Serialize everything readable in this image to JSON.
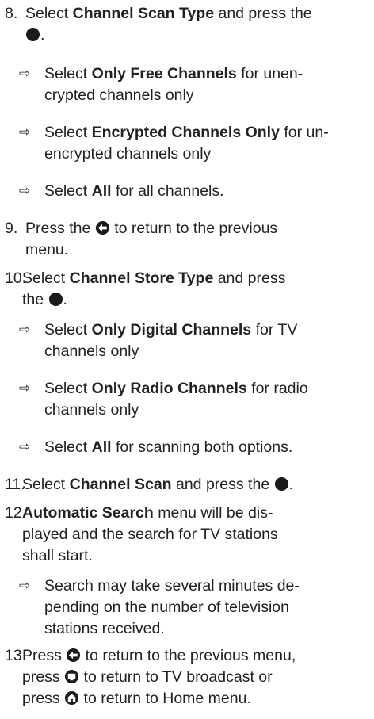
{
  "steps": {
    "s8": {
      "num": "8.",
      "t1": "Select ",
      "b1": "Channel Scan Type",
      "t2": " and press the",
      "t3": ".",
      "o1": {
        "t1": "Select ",
        "b": "Only Free Channels",
        "t2": " for unen-",
        "t3": "crypted channels only"
      },
      "o2": {
        "t1": "Select ",
        "b": "Encrypted Channels Only",
        "t2": " for un-",
        "t3": "encrypted channels only"
      },
      "o3": {
        "t1": "Select ",
        "b": "All",
        "t2": " for all channels."
      }
    },
    "s9": {
      "num": "9.",
      "t1": "Press the ",
      "t2": " to return to the previous",
      "t3": "menu."
    },
    "s10": {
      "num": "10.",
      "t1": "Select ",
      "b1": "Channel Store Type",
      "t2": " and press",
      "t3": "the ",
      "t4": ".",
      "o1": {
        "t1": "Select ",
        "b": "Only Digital Channels",
        "t2": " for TV",
        "t3": "channels only"
      },
      "o2": {
        "t1": "Select ",
        "b": "Only Radio Channels",
        "t2": " for radio",
        "t3": "channels only"
      },
      "o3": {
        "t1": "Select ",
        "b": "All",
        "t2": " for scanning both options."
      }
    },
    "s11": {
      "num": "11.",
      "t1": "Select ",
      "b1": "Channel Scan",
      "t2": " and press the ",
      "t3": "."
    },
    "s12": {
      "num": "12.",
      "b1": "Automatic Search",
      "t1": " menu will be dis-",
      "t2": "played and the search for TV stations",
      "t3": "shall start.",
      "o1": {
        "t1": "Search may take several minutes de-",
        "t2": "pending on the number of television",
        "t3": "stations received."
      }
    },
    "s13": {
      "num": "13.",
      "t1": "Press ",
      "t2": " to return to the previous menu,",
      "t3": "press ",
      "t4": " to return to TV broadcast or",
      "t5": "press ",
      "t6": " to return to Home menu."
    }
  }
}
